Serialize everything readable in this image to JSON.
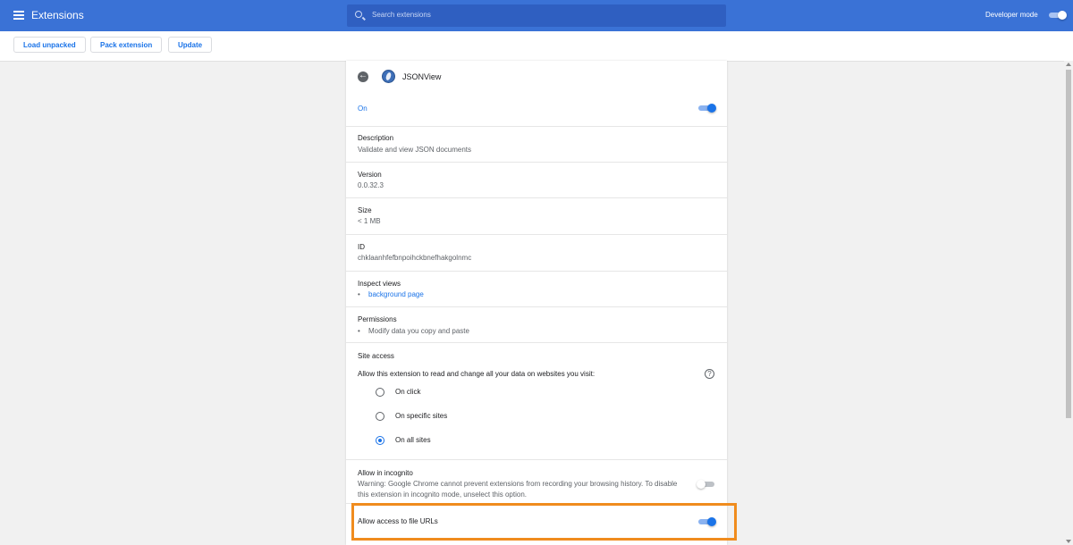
{
  "header": {
    "title": "Extensions",
    "search_placeholder": "Search extensions",
    "dev_mode_label": "Developer mode"
  },
  "toolbar": {
    "load_unpacked": "Load unpacked",
    "pack_extension": "Pack extension",
    "update": "Update"
  },
  "extension": {
    "name": "JSONView",
    "status": "On",
    "description_label": "Description",
    "description": "Validate and view JSON documents",
    "version_label": "Version",
    "version": "0.0.32.3",
    "size_label": "Size",
    "size": "< 1 MB",
    "id_label": "ID",
    "id": "chklaanhfefbnpoihckbnefhakgolnmc",
    "inspect_label": "Inspect views",
    "inspect_link": "background page",
    "permissions_label": "Permissions",
    "permission_item": "Modify data you copy and paste",
    "site_access_label": "Site access",
    "site_access_prompt": "Allow this extension to read and change all your data on websites you visit:",
    "site_access_options": [
      "On click",
      "On specific sites",
      "On all sites"
    ],
    "incognito_label": "Allow in incognito",
    "incognito_warning_1": "Warning: Google Chrome cannot prevent extensions from recording your browsing history. To disable",
    "incognito_warning_2": "this extension in incognito mode, unselect this option.",
    "file_urls_label": "Allow access to file URLs"
  },
  "bullet": "•",
  "help_glyph": "?",
  "colors": {
    "header": "#3a72d6",
    "accent": "#1a73e8",
    "highlight": "#f08c1e"
  }
}
